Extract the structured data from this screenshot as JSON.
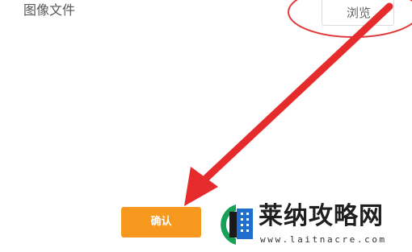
{
  "form": {
    "image_file_label": "图像文件",
    "browse_label": "浏览",
    "confirm_label": "确认"
  },
  "watermark": {
    "name": "莱纳攻略网",
    "url": "www.laitnacre.com"
  },
  "colors": {
    "confirm_button": "#f7991f",
    "annotation_red": "#e52b2b",
    "logo_green": "#16a058",
    "logo_blue": "#1f6fcf"
  },
  "icons": {
    "annotation_arrow": "red-arrow-icon",
    "annotation_circle": "red-circle-icon",
    "watermark_logo": "site-logo-icon"
  }
}
